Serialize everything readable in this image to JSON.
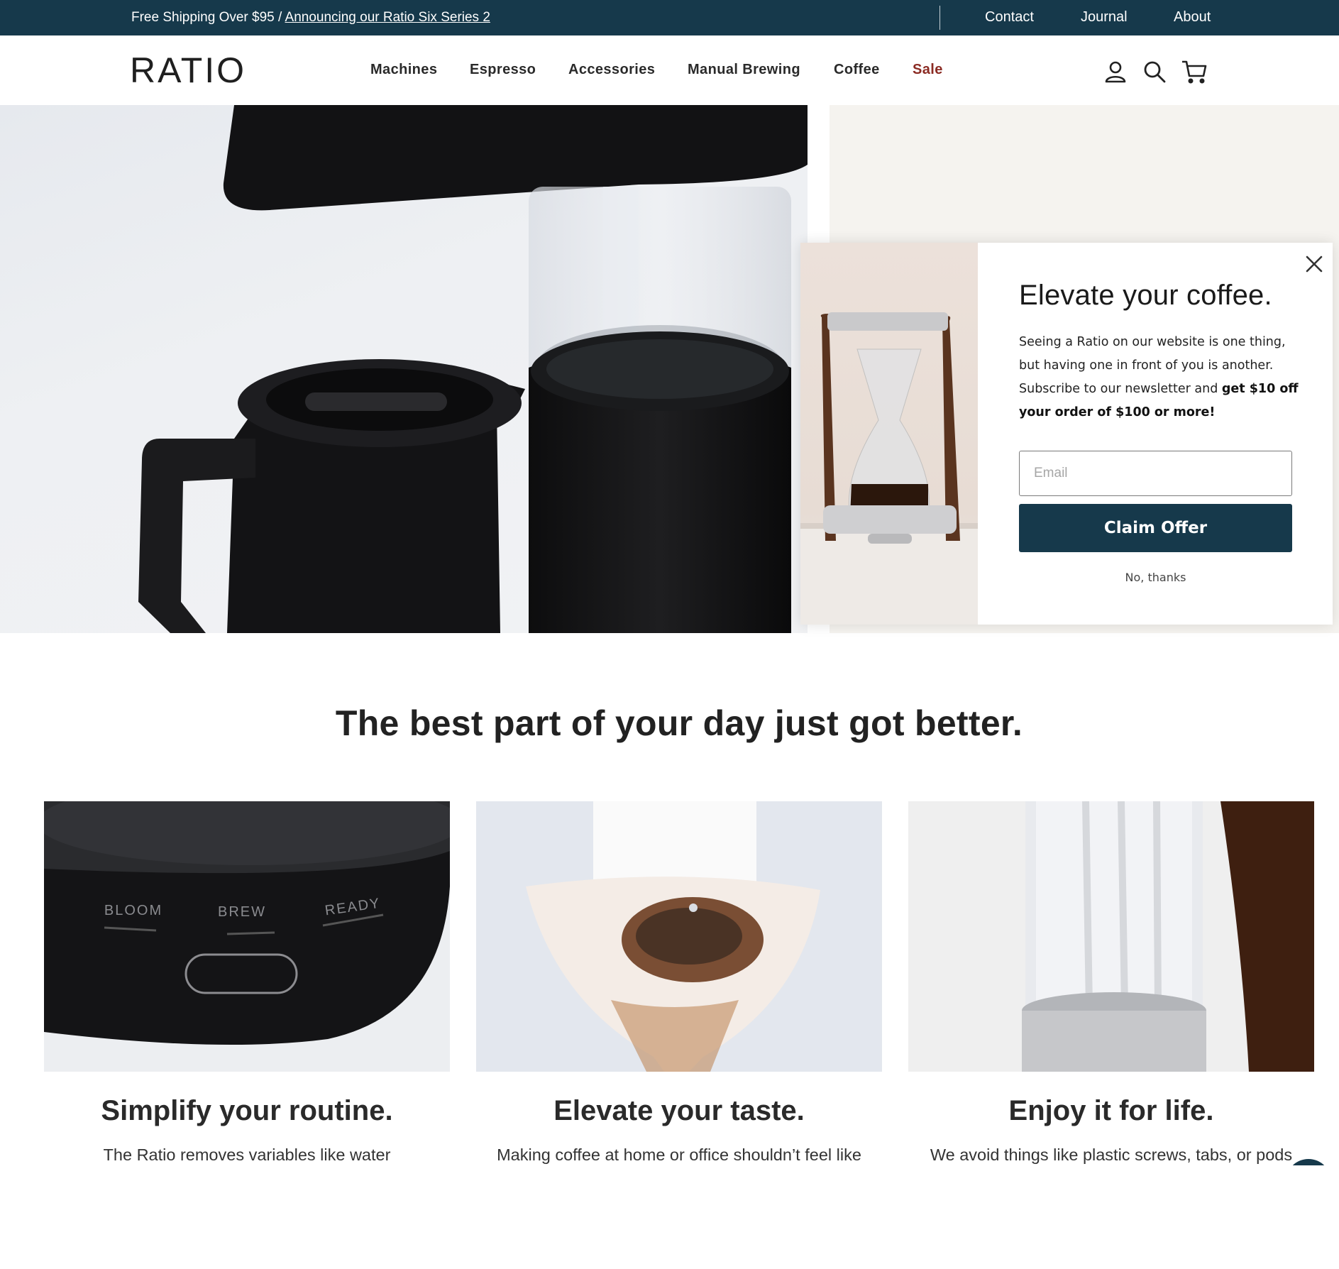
{
  "announcement": {
    "shipping_text": "Free Shipping Over $95 / ",
    "link_text": "Announcing our Ratio Six Series 2",
    "utility_links": [
      "Contact",
      "Journal",
      "About"
    ]
  },
  "header": {
    "logo": "RATIO",
    "nav": [
      "Machines",
      "Espresso",
      "Accessories",
      "Manual Brewing",
      "Coffee",
      "Sale"
    ],
    "icons": [
      "account-icon",
      "search-icon",
      "cart-icon"
    ]
  },
  "popup": {
    "title": "Elevate your coffee.",
    "body_text": "Seeing a Ratio on our website is one thing, but having one in front of you is another. Subscribe to our newsletter and ",
    "body_bold": "get $10 off your order of $100 or more!",
    "email_placeholder": "Email",
    "claim_label": "Claim Offer",
    "decline_label": "No, thanks"
  },
  "section": {
    "title": "The best part of your day just got better."
  },
  "features": [
    {
      "title": "Simplify your routine.",
      "desc": "The Ratio removes variables like water",
      "panel_labels": [
        "BLOOM",
        "BREW",
        "READY"
      ]
    },
    {
      "title": "Elevate your taste.",
      "desc": "Making coffee at home or office shouldn’t feel like"
    },
    {
      "title": "Enjoy it for life.",
      "desc": "We avoid things like plastic screws, tabs, or pods"
    }
  ],
  "colors": {
    "brand_navy": "#16394b",
    "sale_red": "#8b2b23"
  }
}
